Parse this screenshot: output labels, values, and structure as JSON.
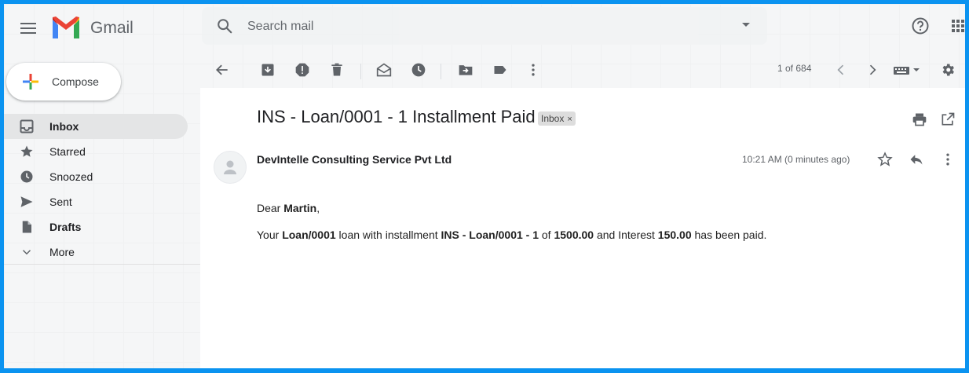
{
  "header": {
    "brand": "Gmail",
    "search_placeholder": "Search mail"
  },
  "sidebar": {
    "compose_label": "Compose",
    "items": [
      {
        "label": "Inbox",
        "icon": "inbox-icon"
      },
      {
        "label": "Starred",
        "icon": "star-icon"
      },
      {
        "label": "Snoozed",
        "icon": "clock-icon"
      },
      {
        "label": "Sent",
        "icon": "send-icon"
      },
      {
        "label": "Drafts",
        "icon": "draft-icon"
      },
      {
        "label": "More",
        "icon": "chevron-down-icon"
      }
    ]
  },
  "toolbar": {
    "pager": "1 of 684"
  },
  "email": {
    "subject": "INS - Loan/0001 - 1 Installment Paid",
    "label": "Inbox",
    "label_close": "×",
    "sender": "DevIntelle Consulting Service Pvt Ltd",
    "time": "10:21 AM (0 minutes ago)",
    "greeting_prefix": "Dear ",
    "greeting_name": "Martin",
    "greeting_suffix": ",",
    "line_parts": [
      {
        "text": "Your ",
        "bold": false
      },
      {
        "text": "Loan/0001",
        "bold": true
      },
      {
        "text": " loan with installment ",
        "bold": false
      },
      {
        "text": "INS - Loan/0001 - 1",
        "bold": true
      },
      {
        "text": " of ",
        "bold": false
      },
      {
        "text": "1500.00",
        "bold": true
      },
      {
        "text": " and Interest ",
        "bold": false
      },
      {
        "text": "150.00",
        "bold": true
      },
      {
        "text": " has been paid.",
        "bold": false
      }
    ]
  },
  "colors": {
    "frame": "#0b93f0",
    "gmail_red": "#ea4335",
    "compose_blue": "#4285f4",
    "compose_green": "#34a853",
    "compose_yellow": "#fbbc04"
  }
}
